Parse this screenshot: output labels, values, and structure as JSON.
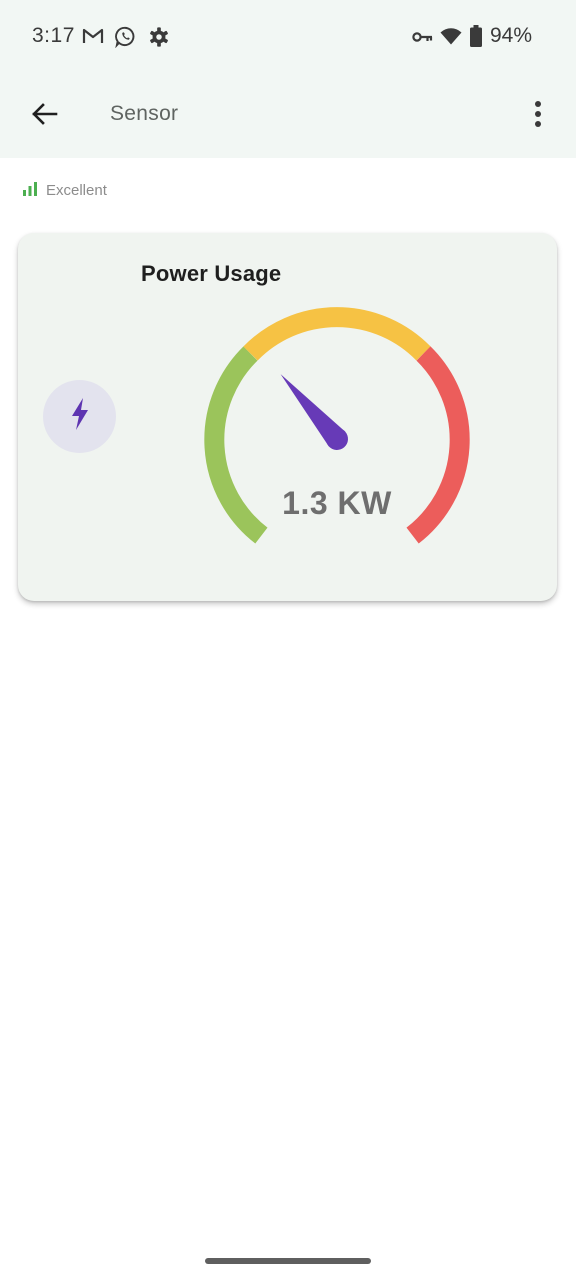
{
  "status_bar": {
    "time": "3:17",
    "battery": "94%",
    "icons": [
      "gmail-icon",
      "whatsapp-icon",
      "settings-gear-icon",
      "vpn-key-icon",
      "wifi-icon",
      "battery-icon"
    ]
  },
  "app_bar": {
    "title": "Sensor",
    "back_icon": "arrow-back-icon",
    "menu_icon": "more-vert-icon"
  },
  "signal": {
    "label": "Excellent",
    "icon": "signal-bars-icon",
    "color": "#4caf50"
  },
  "card": {
    "title": "Power Usage",
    "icon": "bolt-icon",
    "icon_color": "#5e35b1",
    "gauge": {
      "value_text": "1.3 KW",
      "segment_colors": [
        "#9bc45b",
        "#f6c244",
        "#ec5d5b"
      ],
      "needle_color": "#673ab7"
    }
  }
}
